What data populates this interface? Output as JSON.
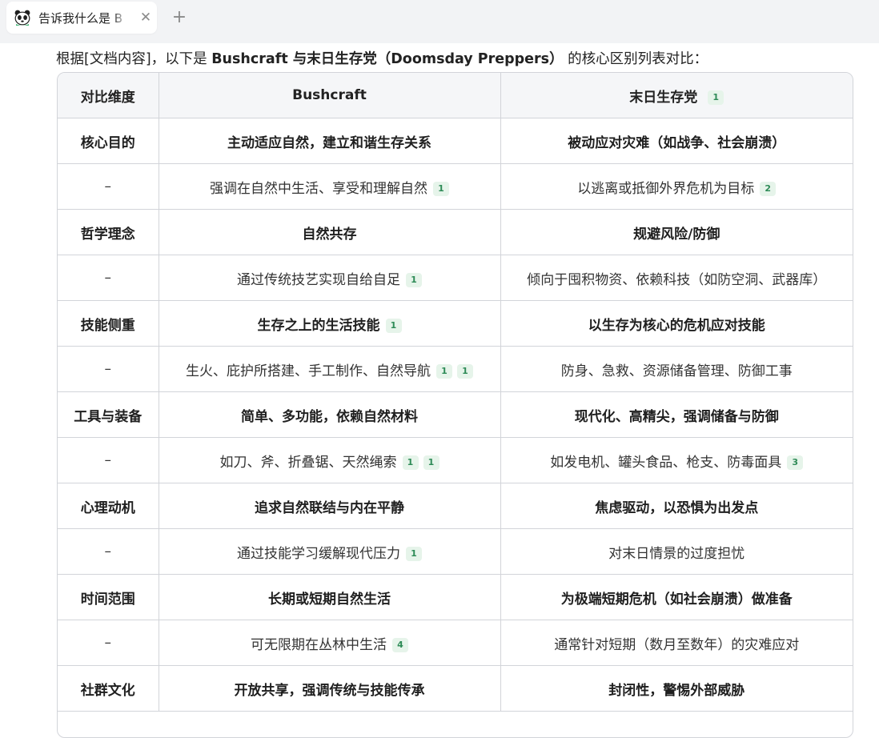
{
  "tab": {
    "title": "告诉我什么是 B",
    "icon": "panda-icon"
  },
  "intro": {
    "prefix": "根据[文档内容]，以下是 ",
    "emphasis": "Bushcraft 与末日生存党（Doomsday Preppers）",
    "suffix": " 的核心区别列表对比："
  },
  "table": {
    "headers": [
      {
        "text": "对比维度",
        "cites": []
      },
      {
        "text": "Bushcraft",
        "cites": []
      },
      {
        "text": "末日生存党",
        "cites": [
          "1"
        ]
      }
    ],
    "rows": [
      {
        "kind": "main",
        "cells": [
          {
            "text": "核心目的",
            "cites": []
          },
          {
            "text": "主动适应自然，建立和谐生存关系",
            "cites": []
          },
          {
            "text": "被动应对灾难（如战争、社会崩溃）",
            "cites": []
          }
        ]
      },
      {
        "kind": "sub",
        "cells": [
          {
            "text": "–",
            "cites": []
          },
          {
            "text": "强调在自然中生活、享受和理解自然",
            "cites": [
              "1"
            ]
          },
          {
            "text": "以逃离或抵御外界危机为目标",
            "cites": [
              "2"
            ]
          }
        ]
      },
      {
        "kind": "main",
        "cells": [
          {
            "text": "哲学理念",
            "cites": []
          },
          {
            "text": "自然共存",
            "cites": []
          },
          {
            "text": "规避风险/防御",
            "cites": []
          }
        ]
      },
      {
        "kind": "sub",
        "cells": [
          {
            "text": "–",
            "cites": []
          },
          {
            "text": "通过传统技艺实现自给自足",
            "cites": [
              "1"
            ]
          },
          {
            "text": "倾向于囤积物资、依赖科技（如防空洞、武器库）",
            "cites": []
          }
        ]
      },
      {
        "kind": "main",
        "cells": [
          {
            "text": "技能侧重",
            "cites": []
          },
          {
            "text": "生存之上的生活技能",
            "cites": [
              "1"
            ]
          },
          {
            "text": "以生存为核心的危机应对技能",
            "cites": []
          }
        ]
      },
      {
        "kind": "sub",
        "cells": [
          {
            "text": "–",
            "cites": []
          },
          {
            "text": "生火、庇护所搭建、手工制作、自然导航",
            "cites": [
              "1",
              "1"
            ]
          },
          {
            "text": "防身、急救、资源储备管理、防御工事",
            "cites": []
          }
        ]
      },
      {
        "kind": "main",
        "cells": [
          {
            "text": "工具与装备",
            "cites": []
          },
          {
            "text": "简单、多功能，依赖自然材料",
            "cites": []
          },
          {
            "text": "现代化、高精尖，强调储备与防御",
            "cites": []
          }
        ]
      },
      {
        "kind": "sub",
        "cells": [
          {
            "text": "–",
            "cites": []
          },
          {
            "text": "如刀、斧、折叠锯、天然绳索",
            "cites": [
              "1",
              "1"
            ]
          },
          {
            "text": "如发电机、罐头食品、枪支、防毒面具",
            "cites": [
              "3"
            ]
          }
        ]
      },
      {
        "kind": "main",
        "cells": [
          {
            "text": "心理动机",
            "cites": []
          },
          {
            "text": "追求自然联结与内在平静",
            "cites": []
          },
          {
            "text": "焦虑驱动，以恐惧为出发点",
            "cites": []
          }
        ]
      },
      {
        "kind": "sub",
        "cells": [
          {
            "text": "–",
            "cites": []
          },
          {
            "text": "通过技能学习缓解现代压力",
            "cites": [
              "1"
            ]
          },
          {
            "text": "对末日情景的过度担忧",
            "cites": []
          }
        ]
      },
      {
        "kind": "main",
        "cells": [
          {
            "text": "时间范围",
            "cites": []
          },
          {
            "text": "长期或短期自然生活",
            "cites": []
          },
          {
            "text": "为极端短期危机（如社会崩溃）做准备",
            "cites": []
          }
        ]
      },
      {
        "kind": "sub",
        "cells": [
          {
            "text": "–",
            "cites": []
          },
          {
            "text": "可无限期在丛林中生活",
            "cites": [
              "4"
            ]
          },
          {
            "text": "通常针对短期（数月至数年）的灾难应对",
            "cites": []
          }
        ]
      },
      {
        "kind": "main",
        "cells": [
          {
            "text": "社群文化",
            "cites": []
          },
          {
            "text": "开放共享，强调传统与技能传承",
            "cites": []
          },
          {
            "text": "封闭性，警惕外部威胁",
            "cites": []
          }
        ]
      }
    ]
  },
  "colors": {
    "cite_bg": "#e6f4ea",
    "cite_text": "#2e8b57",
    "header_bg": "#f5f6f8",
    "border": "#d2d4d9",
    "tabbar_bg": "#f2f3f5"
  }
}
